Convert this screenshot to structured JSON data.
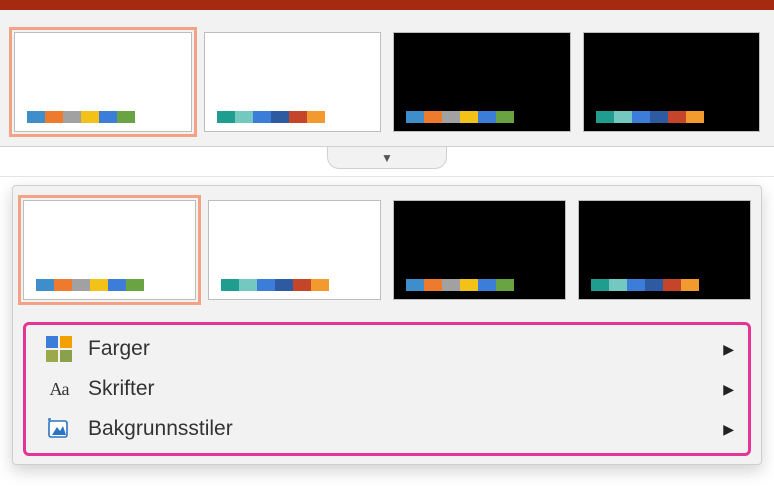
{
  "themes_top": [
    {
      "bg": "light",
      "selected": true,
      "swatches": [
        "#3d8ecb",
        "#ee7a2e",
        "#a1a1a1",
        "#f2c218",
        "#3b7dd8",
        "#6aa341"
      ]
    },
    {
      "bg": "light",
      "selected": false,
      "swatches": [
        "#1f9e8f",
        "#73c8bf",
        "#3b7dd8",
        "#2d5aa0",
        "#c4452a",
        "#f29a2e"
      ]
    },
    {
      "bg": "dark",
      "selected": false,
      "swatches": [
        "#3d8ecb",
        "#ee7a2e",
        "#a1a1a1",
        "#f2c218",
        "#3b7dd8",
        "#6aa341"
      ]
    },
    {
      "bg": "dark",
      "selected": false,
      "swatches": [
        "#1f9e8f",
        "#73c8bf",
        "#3b7dd8",
        "#2d5aa0",
        "#c4452a",
        "#f29a2e"
      ]
    }
  ],
  "themes_dropdown": [
    {
      "bg": "light",
      "selected": true,
      "swatches": [
        "#3d8ecb",
        "#ee7a2e",
        "#a1a1a1",
        "#f2c218",
        "#3b7dd8",
        "#6aa341"
      ]
    },
    {
      "bg": "light",
      "selected": false,
      "swatches": [
        "#1f9e8f",
        "#73c8bf",
        "#3b7dd8",
        "#2d5aa0",
        "#c4452a",
        "#f29a2e"
      ]
    },
    {
      "bg": "dark",
      "selected": false,
      "swatches": [
        "#3d8ecb",
        "#ee7a2e",
        "#a1a1a1",
        "#f2c218",
        "#3b7dd8",
        "#6aa341"
      ]
    },
    {
      "bg": "dark",
      "selected": false,
      "swatches": [
        "#1f9e8f",
        "#73c8bf",
        "#3b7dd8",
        "#2d5aa0",
        "#c4452a",
        "#f29a2e"
      ]
    }
  ],
  "menu": {
    "colors": "Farger",
    "fonts": "Skrifter",
    "background_styles": "Bakgrunnsstiler"
  }
}
